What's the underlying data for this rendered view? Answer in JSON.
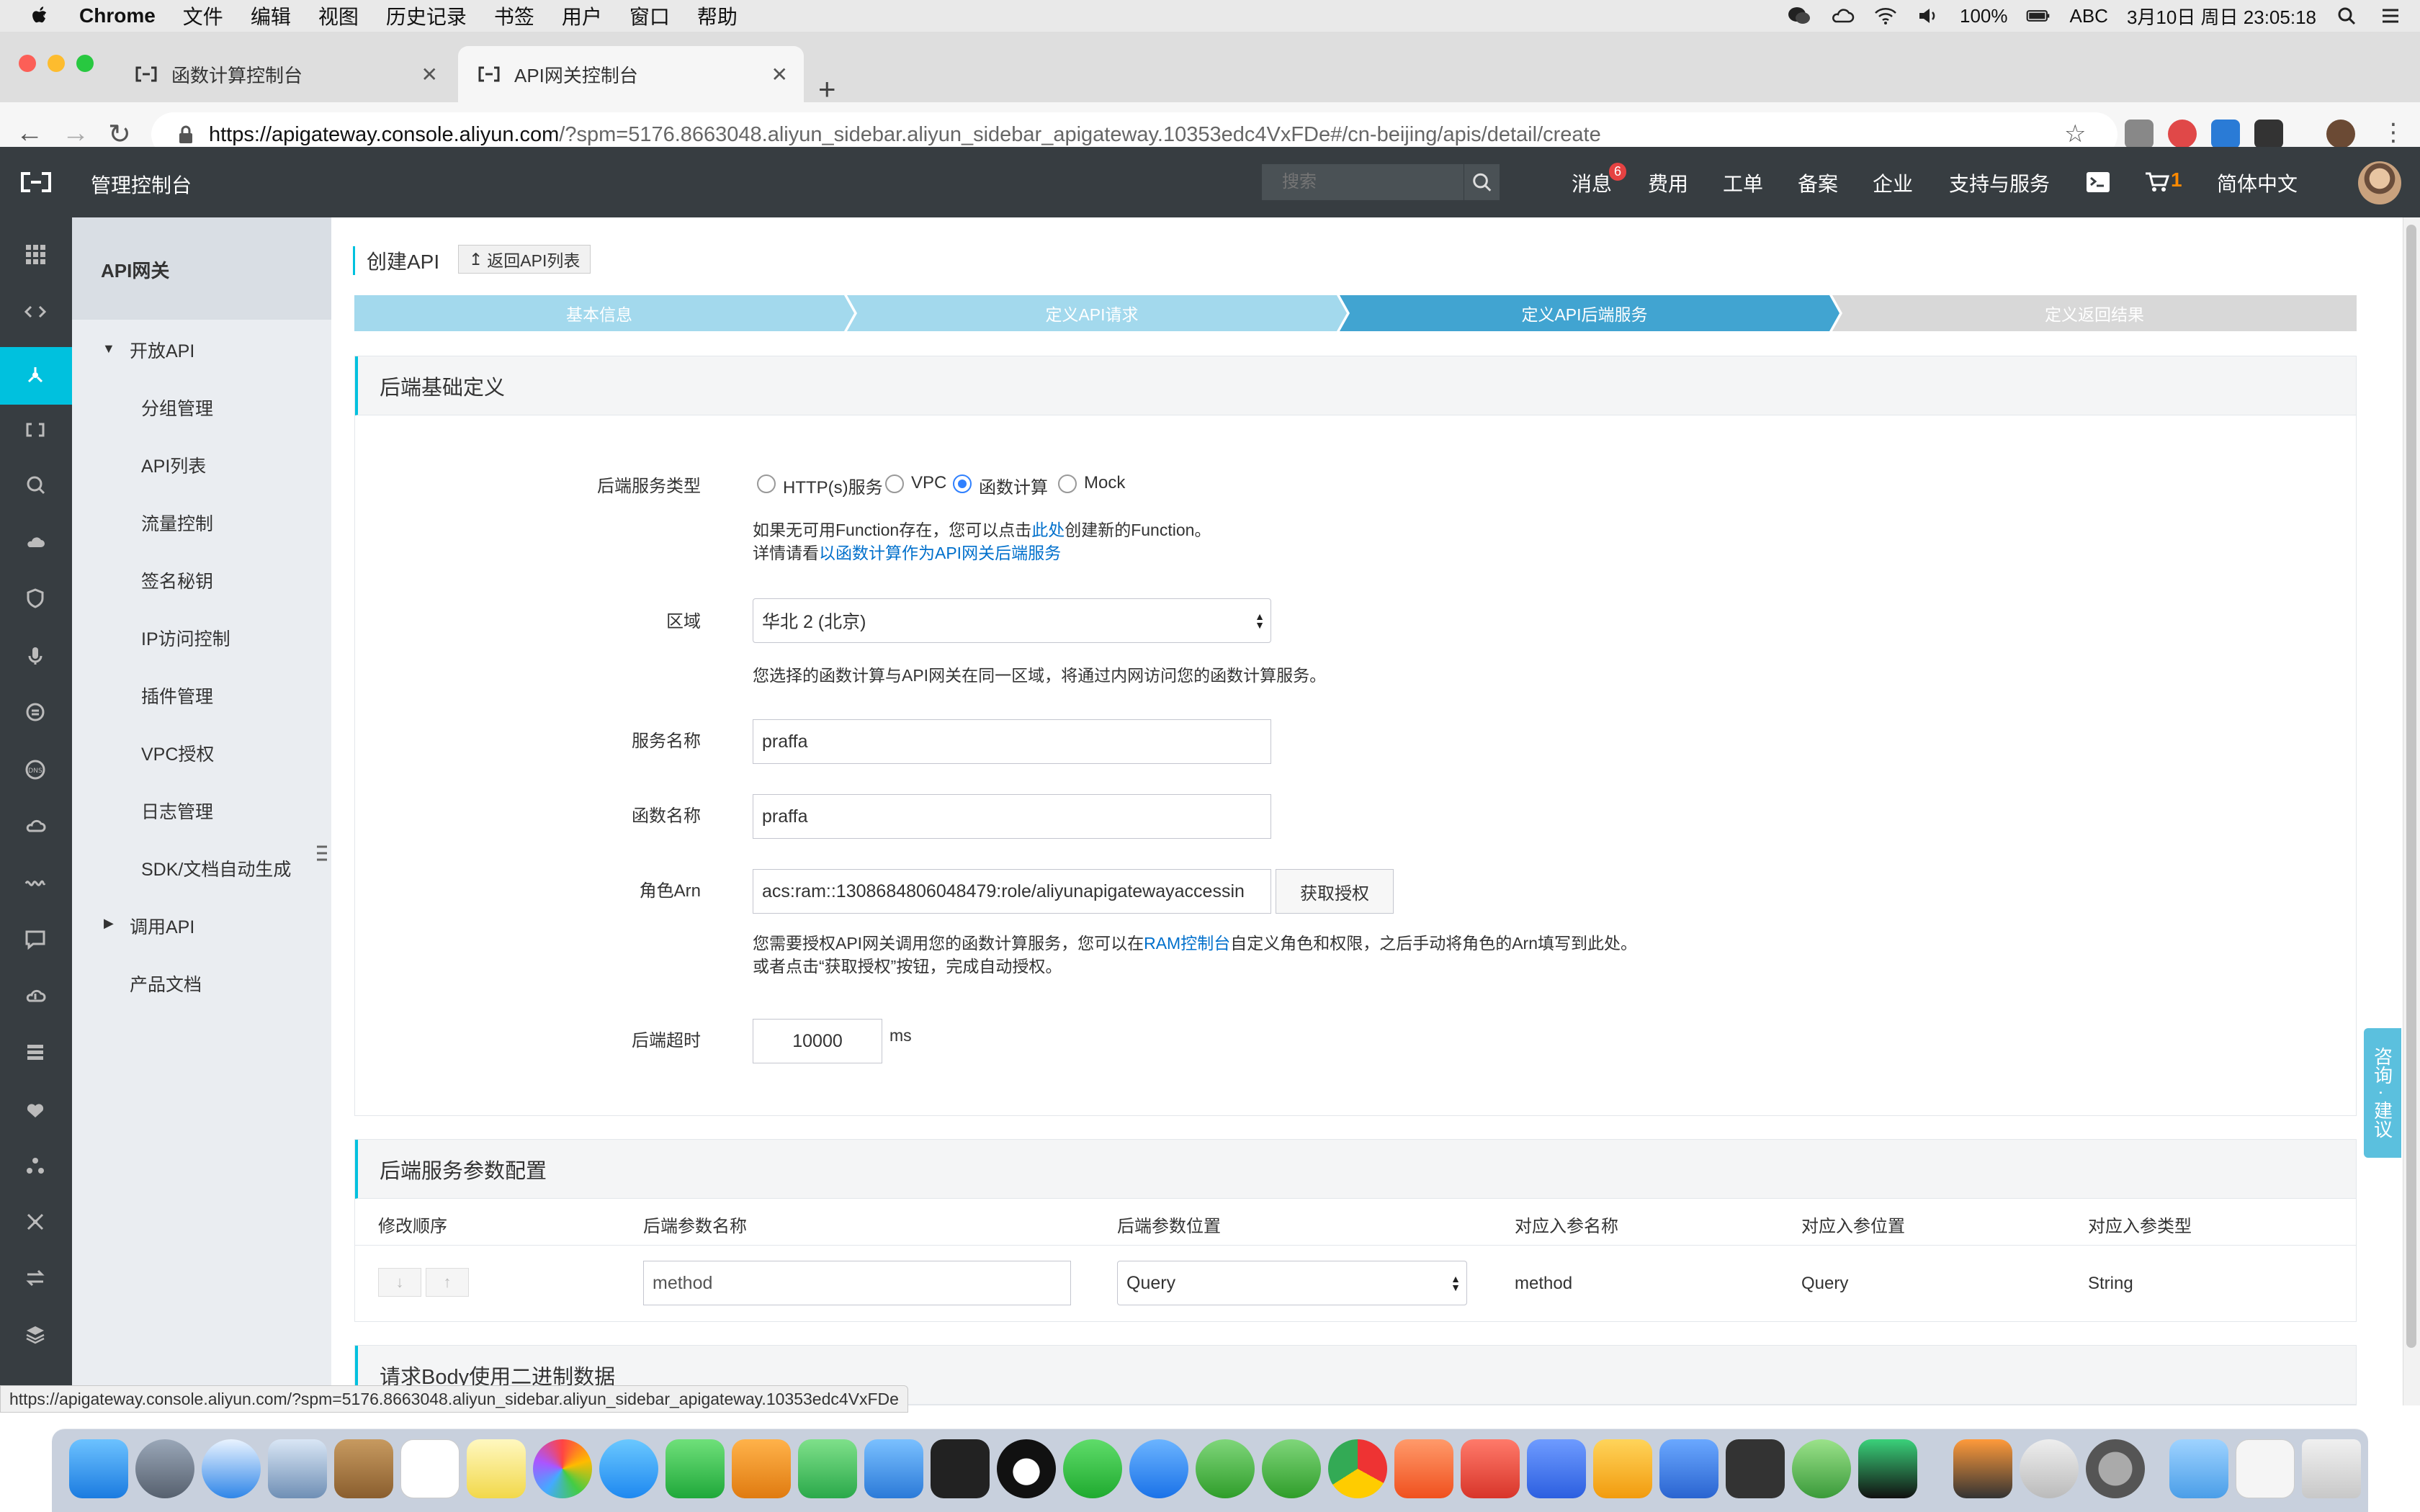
{
  "menubar": {
    "app": "Chrome",
    "items": [
      "文件",
      "编辑",
      "视图",
      "历史记录",
      "书签",
      "用户",
      "窗口",
      "帮助"
    ],
    "battery": "100%",
    "input_method": "ABC",
    "clock": "3月10日 周日  23:05:18"
  },
  "browser": {
    "tabs": [
      {
        "title": "函数计算控制台",
        "active": false
      },
      {
        "title": "API网关控制台",
        "active": true
      }
    ],
    "url_host": "https://apigateway.console.aliyun.com",
    "url_rest": "/?spm=5176.8663048.aliyun_sidebar.aliyun_sidebar_apigateway.10353edc4VxFDe#/cn-beijing/apis/detail/create",
    "status_url": "https://apigateway.console.aliyun.com/?spm=5176.8663048.aliyun_sidebar.aliyun_sidebar_apigateway.10353edc4VxFDe"
  },
  "header": {
    "title": "管理控制台",
    "search_placeholder": "搜索",
    "messages_label": "消息",
    "messages_count": "6",
    "nav": [
      "费用",
      "工单",
      "备案",
      "企业",
      "支持与服务"
    ],
    "cart_count": "1",
    "language": "简体中文"
  },
  "sidebar": {
    "title": "API网关",
    "open_api": "开放API",
    "items": [
      "分组管理",
      "API列表",
      "流量控制",
      "签名秘钥",
      "IP访问控制",
      "插件管理",
      "VPC授权",
      "日志管理",
      "SDK/文档自动生成"
    ],
    "call_api": "调用API",
    "docs": "产品文档"
  },
  "page": {
    "title": "创建API",
    "back_label": "返回API列表",
    "steps": [
      "基本信息",
      "定义API请求",
      "定义API后端服务",
      "定义返回结果"
    ],
    "active_step": 2
  },
  "backend": {
    "section_title": "后端基础定义",
    "type_label": "后端服务类型",
    "types": [
      "HTTP(s)服务",
      "VPC",
      "函数计算",
      "Mock"
    ],
    "selected_type": "函数计算",
    "note1_pre": "如果无可用Function存在，您可以点击",
    "note1_link": "此处",
    "note1_post": "创建新的Function。",
    "note2_pre": "详情请看",
    "note2_link": "以函数计算作为API网关后端服务",
    "region_label": "区域",
    "region_value": "华北 2 (北京)",
    "region_note": "您选择的函数计算与API网关在同一区域，将通过内网访问您的函数计算服务。",
    "service_label": "服务名称",
    "service_value": "praffa",
    "function_label": "函数名称",
    "function_value": "praffa",
    "role_label": "角色Arn",
    "role_value": "acs:ram::1308684806048479:role/aliyunapigatewayaccessin",
    "auth_button": "获取授权",
    "role_note1_pre": "您需要授权API网关调用您的函数计算服务，您可以在",
    "role_note1_link": "RAM控制台",
    "role_note1_post": "自定义角色和权限，之后手动将角色的Arn填写到此处。",
    "role_note2": "或者点击“获取授权”按钮，完成自动授权。",
    "timeout_label": "后端超时",
    "timeout_value": "10000",
    "timeout_unit": "ms"
  },
  "params": {
    "section_title": "后端服务参数配置",
    "columns": [
      "修改顺序",
      "后端参数名称",
      "后端参数位置",
      "对应入参名称",
      "对应入参位置",
      "对应入参类型"
    ],
    "rows": [
      {
        "name": "method",
        "position": "Query",
        "in_name": "method",
        "in_position": "Query",
        "in_type": "String"
      }
    ]
  },
  "binary": {
    "section_title": "请求Body使用二进制数据"
  },
  "feedback": "咨询 · 建议",
  "colors": {
    "accent": "#00c1de",
    "header_bg": "#373d41",
    "step_done": "#a3d9ed",
    "step_active": "#41a4d1",
    "step_todo": "#d8d8d8",
    "link": "#0070cc"
  }
}
